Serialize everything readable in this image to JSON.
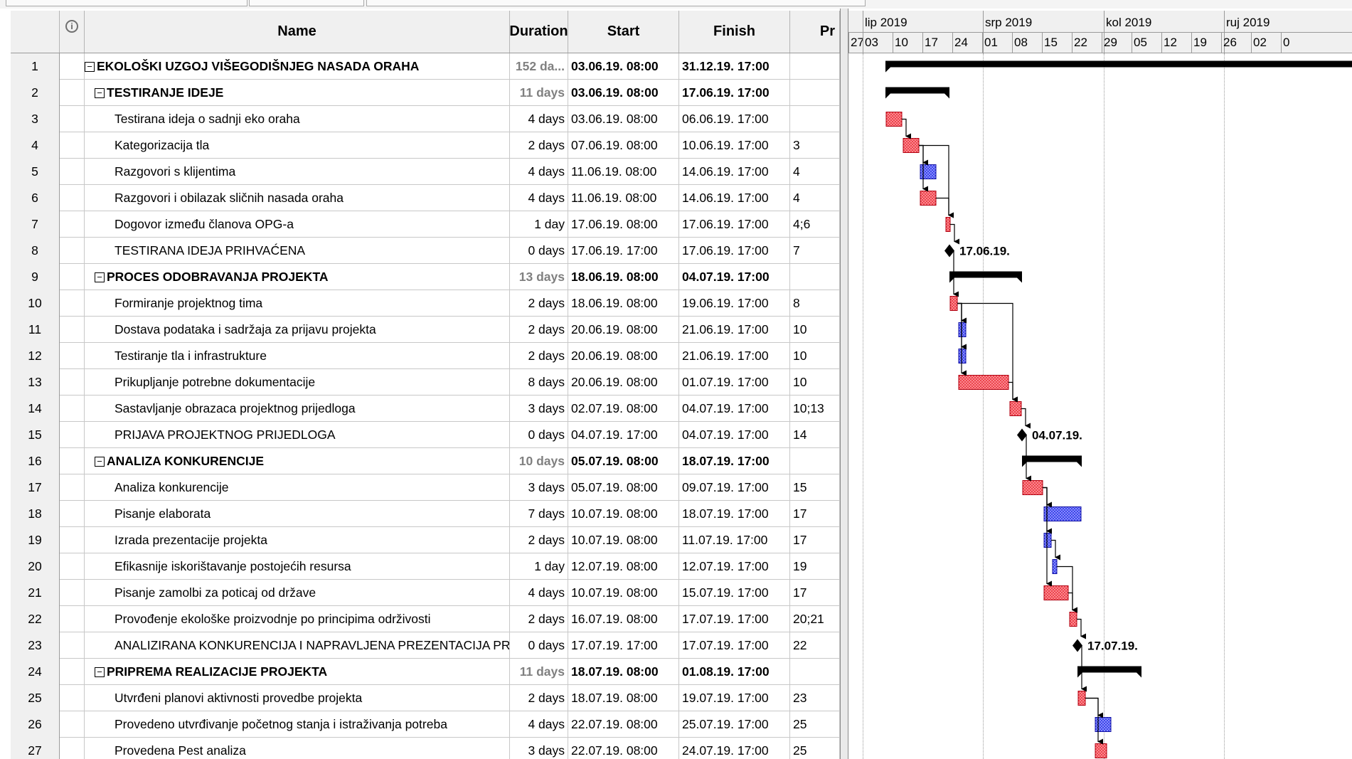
{
  "columns": {
    "id": "",
    "indicators_icon": "indicators-icon",
    "name": "Name",
    "duration": "Duration",
    "start": "Start",
    "finish": "Finish",
    "predecessors": "Pr"
  },
  "timescale": {
    "months": [
      "lip 2019",
      "srp 2019",
      "kol 2019",
      "ruj 2019"
    ],
    "weeks": [
      "27",
      "03",
      "10",
      "17",
      "24",
      "01",
      "08",
      "15",
      "22",
      "29",
      "05",
      "12",
      "19",
      "26",
      "02",
      "0"
    ]
  },
  "milestone_labels": {
    "m8": "17.06.19.",
    "m15": "04.07.19.",
    "m23": "17.07.19."
  },
  "tasks": [
    {
      "id": "1",
      "summary": true,
      "level": 0,
      "name": "EKOLOŠKI UZGOJ VIŠEGODIŠNJEG NASADA ORAHA",
      "duration": "152 da...",
      "start": "03.06.19. 08:00",
      "finish": "31.12.19. 17:00",
      "pred": ""
    },
    {
      "id": "2",
      "summary": true,
      "level": 1,
      "name": "TESTIRANJE IDEJE",
      "duration": "11 days",
      "start": "03.06.19. 08:00",
      "finish": "17.06.19. 17:00",
      "pred": ""
    },
    {
      "id": "3",
      "summary": false,
      "level": 2,
      "name": "Testirana ideja o sadnji eko oraha",
      "duration": "4 days",
      "start": "03.06.19. 08:00",
      "finish": "06.06.19. 17:00",
      "pred": ""
    },
    {
      "id": "4",
      "summary": false,
      "level": 2,
      "name": "Kategorizacija tla",
      "duration": "2 days",
      "start": "07.06.19. 08:00",
      "finish": "10.06.19. 17:00",
      "pred": "3"
    },
    {
      "id": "5",
      "summary": false,
      "level": 2,
      "name": "Razgovori s klijentima",
      "duration": "4 days",
      "start": "11.06.19. 08:00",
      "finish": "14.06.19. 17:00",
      "pred": "4"
    },
    {
      "id": "6",
      "summary": false,
      "level": 2,
      "name": "Razgovori i obilazak sličnih nasada oraha",
      "duration": "4 days",
      "start": "11.06.19. 08:00",
      "finish": "14.06.19. 17:00",
      "pred": "4"
    },
    {
      "id": "7",
      "summary": false,
      "level": 2,
      "name": "Dogovor između članova OPG-a",
      "duration": "1 day",
      "start": "17.06.19. 08:00",
      "finish": "17.06.19. 17:00",
      "pred": "4;6"
    },
    {
      "id": "8",
      "summary": false,
      "level": 2,
      "name": "TESTIRANA IDEJA PRIHVAĆENA",
      "duration": "0 days",
      "start": "17.06.19. 17:00",
      "finish": "17.06.19. 17:00",
      "pred": "7"
    },
    {
      "id": "9",
      "summary": true,
      "level": 1,
      "name": "PROCES ODOBRAVANJA PROJEKTA",
      "duration": "13 days",
      "start": "18.06.19. 08:00",
      "finish": "04.07.19. 17:00",
      "pred": ""
    },
    {
      "id": "10",
      "summary": false,
      "level": 2,
      "name": "Formiranje projektnog tima",
      "duration": "2 days",
      "start": "18.06.19. 08:00",
      "finish": "19.06.19. 17:00",
      "pred": "8"
    },
    {
      "id": "11",
      "summary": false,
      "level": 2,
      "name": "Dostava podataka i sadržaja za prijavu projekta",
      "duration": "2 days",
      "start": "20.06.19. 08:00",
      "finish": "21.06.19. 17:00",
      "pred": "10"
    },
    {
      "id": "12",
      "summary": false,
      "level": 2,
      "name": "Testiranje tla i infrastrukture",
      "duration": "2 days",
      "start": "20.06.19. 08:00",
      "finish": "21.06.19. 17:00",
      "pred": "10"
    },
    {
      "id": "13",
      "summary": false,
      "level": 2,
      "name": "Prikupljanje potrebne dokumentacije",
      "duration": "8 days",
      "start": "20.06.19. 08:00",
      "finish": "01.07.19. 17:00",
      "pred": "10"
    },
    {
      "id": "14",
      "summary": false,
      "level": 2,
      "name": "Sastavljanje obrazaca projektnog prijedloga",
      "duration": "3 days",
      "start": "02.07.19. 08:00",
      "finish": "04.07.19. 17:00",
      "pred": "10;13"
    },
    {
      "id": "15",
      "summary": false,
      "level": 2,
      "name": "PRIJAVA PROJEKTNOG PRIJEDLOGA",
      "duration": "0 days",
      "start": "04.07.19. 17:00",
      "finish": "04.07.19. 17:00",
      "pred": "14"
    },
    {
      "id": "16",
      "summary": true,
      "level": 1,
      "name": "ANALIZA KONKURENCIJE",
      "duration": "10 days",
      "start": "05.07.19. 08:00",
      "finish": "18.07.19. 17:00",
      "pred": ""
    },
    {
      "id": "17",
      "summary": false,
      "level": 2,
      "name": "Analiza konkurencije",
      "duration": "3 days",
      "start": "05.07.19. 08:00",
      "finish": "09.07.19. 17:00",
      "pred": "15"
    },
    {
      "id": "18",
      "summary": false,
      "level": 2,
      "name": "Pisanje elaborata",
      "duration": "7 days",
      "start": "10.07.19. 08:00",
      "finish": "18.07.19. 17:00",
      "pred": "17"
    },
    {
      "id": "19",
      "summary": false,
      "level": 2,
      "name": "Izrada prezentacije projekta",
      "duration": "2 days",
      "start": "10.07.19. 08:00",
      "finish": "11.07.19. 17:00",
      "pred": "17"
    },
    {
      "id": "20",
      "summary": false,
      "level": 2,
      "name": "Efikasnije iskorištavanje postojećih resursa",
      "duration": "1 day",
      "start": "12.07.19. 08:00",
      "finish": "12.07.19. 17:00",
      "pred": "19"
    },
    {
      "id": "21",
      "summary": false,
      "level": 2,
      "name": "Pisanje zamolbi za poticaj od države",
      "duration": "4 days",
      "start": "10.07.19. 08:00",
      "finish": "15.07.19. 17:00",
      "pred": "17"
    },
    {
      "id": "22",
      "summary": false,
      "level": 2,
      "name": "Provođenje ekološke proizvodnje po principima održivosti",
      "duration": "2 days",
      "start": "16.07.19. 08:00",
      "finish": "17.07.19. 17:00",
      "pred": "20;21"
    },
    {
      "id": "23",
      "summary": false,
      "level": 2,
      "name": "ANALIZIRANA KONKURENCIJA I NAPRAVLJENA PREZENTACIJA PROJEKTA",
      "duration": "0 days",
      "start": "17.07.19. 17:00",
      "finish": "17.07.19. 17:00",
      "pred": "22"
    },
    {
      "id": "24",
      "summary": true,
      "level": 1,
      "name": "PRIPREMA REALIZACIJE PROJEKTA",
      "duration": "11 days",
      "start": "18.07.19. 08:00",
      "finish": "01.08.19. 17:00",
      "pred": ""
    },
    {
      "id": "25",
      "summary": false,
      "level": 2,
      "name": "Utvrđeni planovi aktivnosti provedbe projekta",
      "duration": "2 days",
      "start": "18.07.19. 08:00",
      "finish": "19.07.19. 17:00",
      "pred": "23"
    },
    {
      "id": "26",
      "summary": false,
      "level": 2,
      "name": "Provedeno utvrđivanje početnog stanja i istraživanja potreba",
      "duration": "4 days",
      "start": "22.07.19. 08:00",
      "finish": "25.07.19. 17:00",
      "pred": "25"
    },
    {
      "id": "27",
      "summary": false,
      "level": 2,
      "name": "Provedena Pest analiza",
      "duration": "3 days",
      "start": "22.07.19. 08:00",
      "finish": "24.07.19. 17:00",
      "pred": "25"
    }
  ],
  "colors": {
    "critical": "#e8323c",
    "noncritical": "#2a32e6",
    "summary": "#000000",
    "grid_header": "#f0f0f0"
  },
  "icons": {
    "collapse": "minus-box-icon"
  }
}
